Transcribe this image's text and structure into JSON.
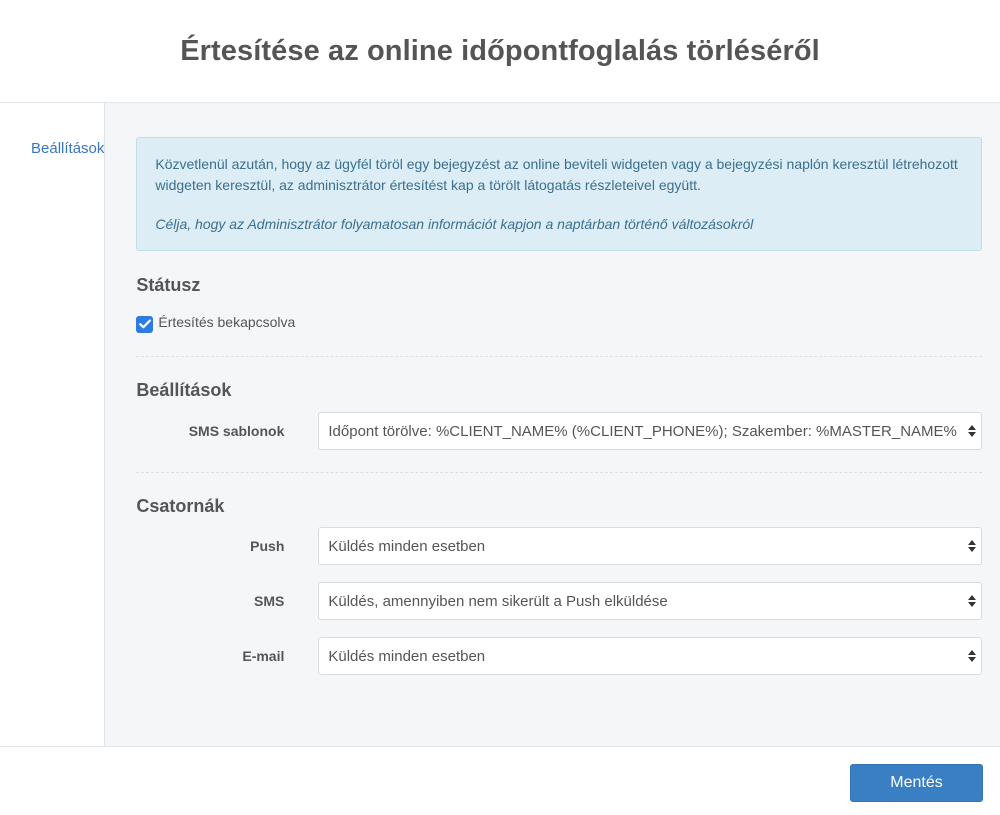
{
  "page": {
    "title": "Értesítése az online időpontfoglalás törléséről"
  },
  "sidebar": {
    "items": [
      {
        "label": "Beállítások"
      }
    ]
  },
  "info": {
    "text": "Közvetlenül azután, hogy az ügyfél töröl egy bejegyzést az online beviteli widgeten vagy a bejegyzési naplón keresztül létrehozott widgeten keresztül, az adminisztrátor értesítést kap a törölt látogatás részleteivel együtt.",
    "purpose": "Célja, hogy az Adminisztrátor folyamatosan információt kapjon a naptárban történő változásokról"
  },
  "status": {
    "title": "Státusz",
    "checkbox_label": "Értesítés bekapcsolva",
    "checked": true
  },
  "settings": {
    "title": "Beállítások",
    "sms_template_label": "SMS sablonok",
    "sms_template_value": "Időpont törölve: %CLIENT_NAME% (%CLIENT_PHONE%); Szakember: %MASTER_NAME%"
  },
  "channels": {
    "title": "Csatornák",
    "push_label": "Push",
    "push_value": "Küldés minden esetben",
    "sms_label": "SMS",
    "sms_value": "Küldés, amennyiben nem sikerült a Push elküldése",
    "email_label": "E-mail",
    "email_value": "Küldés minden esetben"
  },
  "footer": {
    "save_label": "Mentés"
  },
  "colors": {
    "accent": "#3a7fc4",
    "checkbox": "#2e7ce0",
    "info_bg": "#dcedf5",
    "info_text": "#3a6f8f"
  }
}
